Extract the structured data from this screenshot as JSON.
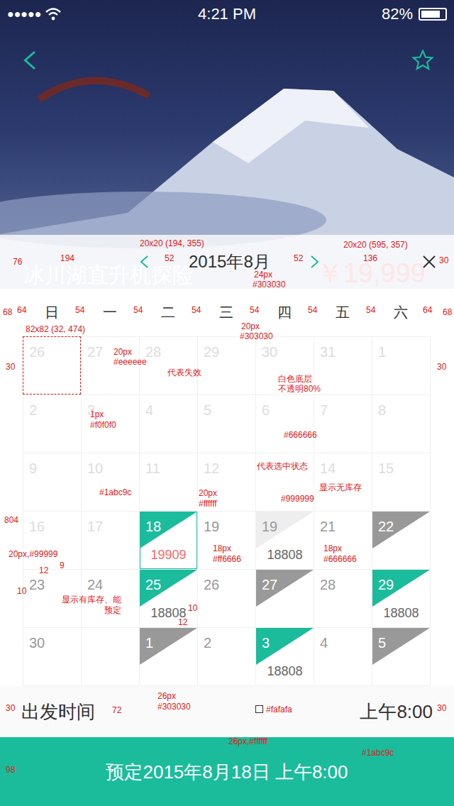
{
  "status_bar": {
    "signal": "●●●●●",
    "time": "4:21 PM",
    "battery": "82%",
    "level": 0.82
  },
  "product": {
    "title": "冰川湖直升机探险",
    "price": "￥19,999"
  },
  "calendar": {
    "month": "2015年8月",
    "weekdays": [
      "日",
      "一",
      "二",
      "三",
      "四",
      "五",
      "六"
    ],
    "weeks": [
      [
        {
          "day": "26",
          "kind": "invalid",
          "price": "",
          "selected": false
        },
        {
          "day": "27",
          "kind": "invalid",
          "price": "",
          "selected": false
        },
        {
          "day": "28",
          "kind": "invalid",
          "price": "",
          "selected": false
        },
        {
          "day": "29",
          "kind": "invalid",
          "price": "",
          "selected": false
        },
        {
          "day": "30",
          "kind": "invalid",
          "price": "",
          "selected": false
        },
        {
          "day": "31",
          "kind": "invalid",
          "price": "",
          "selected": false
        },
        {
          "day": "1",
          "kind": "invalid",
          "price": "",
          "selected": false
        }
      ],
      [
        {
          "day": "2",
          "kind": "invalid",
          "price": "",
          "selected": false
        },
        {
          "day": "3",
          "kind": "invalid",
          "price": "",
          "selected": false
        },
        {
          "day": "4",
          "kind": "invalid",
          "price": "",
          "selected": false
        },
        {
          "day": "5",
          "kind": "invalid",
          "price": "",
          "selected": false
        },
        {
          "day": "6",
          "kind": "invalid",
          "price": "",
          "selected": false
        },
        {
          "day": "7",
          "kind": "invalid",
          "price": "",
          "selected": false
        },
        {
          "day": "8",
          "kind": "invalid",
          "price": "",
          "selected": false
        }
      ],
      [
        {
          "day": "9",
          "kind": "invalid",
          "price": "",
          "selected": false
        },
        {
          "day": "10",
          "kind": "invalid",
          "price": "",
          "selected": false
        },
        {
          "day": "11",
          "kind": "invalid",
          "price": "",
          "selected": false
        },
        {
          "day": "12",
          "kind": "invalid",
          "price": "",
          "selected": false
        },
        {
          "day": "",
          "kind": "invalid",
          "price": "",
          "selected": false
        },
        {
          "day": "14",
          "kind": "invalid",
          "price": "",
          "selected": false
        },
        {
          "day": "15",
          "kind": "invalid",
          "price": "",
          "selected": false
        }
      ],
      [
        {
          "day": "16",
          "kind": "invalid",
          "price": "",
          "selected": false
        },
        {
          "day": "17",
          "kind": "invalid",
          "price": "",
          "selected": false
        },
        {
          "day": "18",
          "kind": "available",
          "price": "19909",
          "selected": true
        },
        {
          "day": "19",
          "kind": "normal",
          "price": "",
          "selected": false
        },
        {
          "day": "19",
          "kind": "pending",
          "price": "18808",
          "selected": false
        },
        {
          "day": "21",
          "kind": "normal",
          "price": "",
          "selected": false
        },
        {
          "day": "22",
          "kind": "soldout",
          "price": "",
          "selected": false
        }
      ],
      [
        {
          "day": "23",
          "kind": "normal",
          "price": "",
          "selected": false
        },
        {
          "day": "24",
          "kind": "normal",
          "price": "",
          "selected": false
        },
        {
          "day": "25",
          "kind": "available",
          "price": "18808",
          "selected": false
        },
        {
          "day": "26",
          "kind": "normal",
          "price": "",
          "selected": false
        },
        {
          "day": "27",
          "kind": "soldout",
          "price": "",
          "selected": false
        },
        {
          "day": "28",
          "kind": "normal",
          "price": "",
          "selected": false
        },
        {
          "day": "29",
          "kind": "available",
          "price": "18808",
          "selected": false
        }
      ],
      [
        {
          "day": "30",
          "kind": "normal",
          "price": "",
          "selected": false
        },
        {
          "day": "",
          "kind": "normal",
          "price": "",
          "selected": false
        },
        {
          "day": "1",
          "kind": "soldout",
          "price": "",
          "selected": false
        },
        {
          "day": "2",
          "kind": "normal",
          "price": "",
          "selected": false
        },
        {
          "day": "3",
          "kind": "available",
          "price": "18808",
          "selected": false
        },
        {
          "day": "4",
          "kind": "normal",
          "price": "",
          "selected": false
        },
        {
          "day": "5",
          "kind": "soldout",
          "price": "",
          "selected": false
        }
      ]
    ]
  },
  "departure": {
    "label": "出发时间",
    "value": "上午8:00"
  },
  "book_button": {
    "label": "预定2015年8月18日 上午8:00"
  },
  "annotations": [
    "76",
    "194",
    "20x20 (194, 355)",
    "52",
    "52",
    "20x20 (595, 357)",
    "136",
    "30",
    "24px",
    "#303030",
    "68",
    "64",
    "54",
    "54",
    "54",
    "54",
    "54",
    "54",
    "64",
    "68",
    "20px",
    "#303030",
    "82x82 (32, 474)",
    "20px",
    "#eeeeee",
    "代表失效",
    "30",
    "30",
    "白色底层",
    "不透明80%",
    "1px",
    "#f0f0f0",
    "#666666",
    "代表选中状态",
    "显示无库存",
    "#1abc9c",
    "20px",
    "#ffffff",
    "#999999",
    "804",
    "18px",
    "#ff6666",
    "18px",
    "#666666",
    "20px,#99999",
    "9",
    "12",
    "10",
    "显示有库存、能",
    "预定",
    "10",
    "12",
    "26px",
    "#303030",
    "30",
    "30",
    "72",
    "#fafafa",
    "26px,#ffffff",
    "#1abc9c",
    "98"
  ]
}
